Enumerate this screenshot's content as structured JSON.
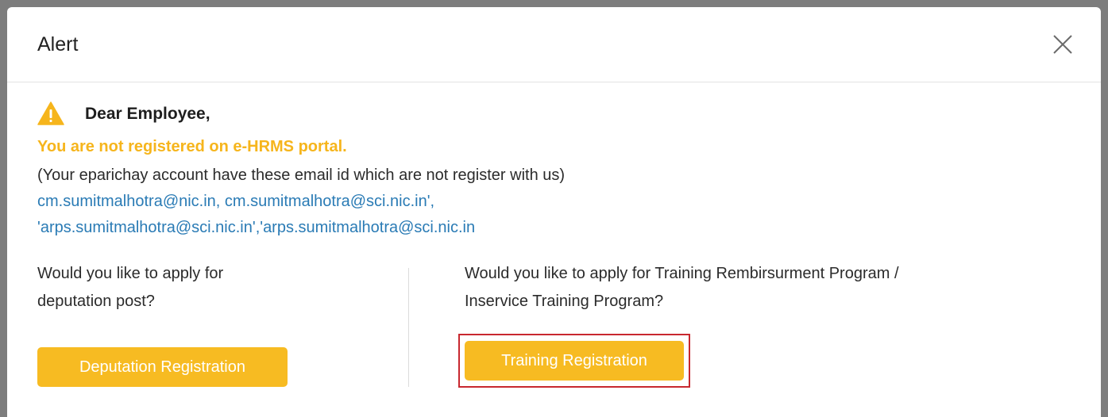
{
  "dialog": {
    "title": "Alert",
    "close_icon": "close-icon"
  },
  "body": {
    "warning_icon": "warning-triangle-icon",
    "greeting": "Dear Employee,",
    "not_registered": "You are not registered on e-HRMS portal.",
    "explanation": "(Your eparichay account have these email id which are not register with us)",
    "emails_line1": "cm.sumitmalhotra@nic.in, cm.sumitmalhotra@sci.nic.in',",
    "emails_line2": "'arps.sumitmalhotra@sci.nic.in','arps.sumitmalhotra@sci.nic.in"
  },
  "deputation": {
    "prompt_line1": "Would you like to apply for",
    "prompt_line2": "deputation post?",
    "button_label": "Deputation Registration"
  },
  "training": {
    "prompt_line1": "Would you like to apply for Training Rembirsurment Program /",
    "prompt_line2": "Inservice Training Program?",
    "button_label": "Training Registration"
  },
  "colors": {
    "accent": "#f7bb22",
    "warning_text": "#f6b51c",
    "link": "#2a7bb5",
    "highlight_border": "#c8282f"
  }
}
